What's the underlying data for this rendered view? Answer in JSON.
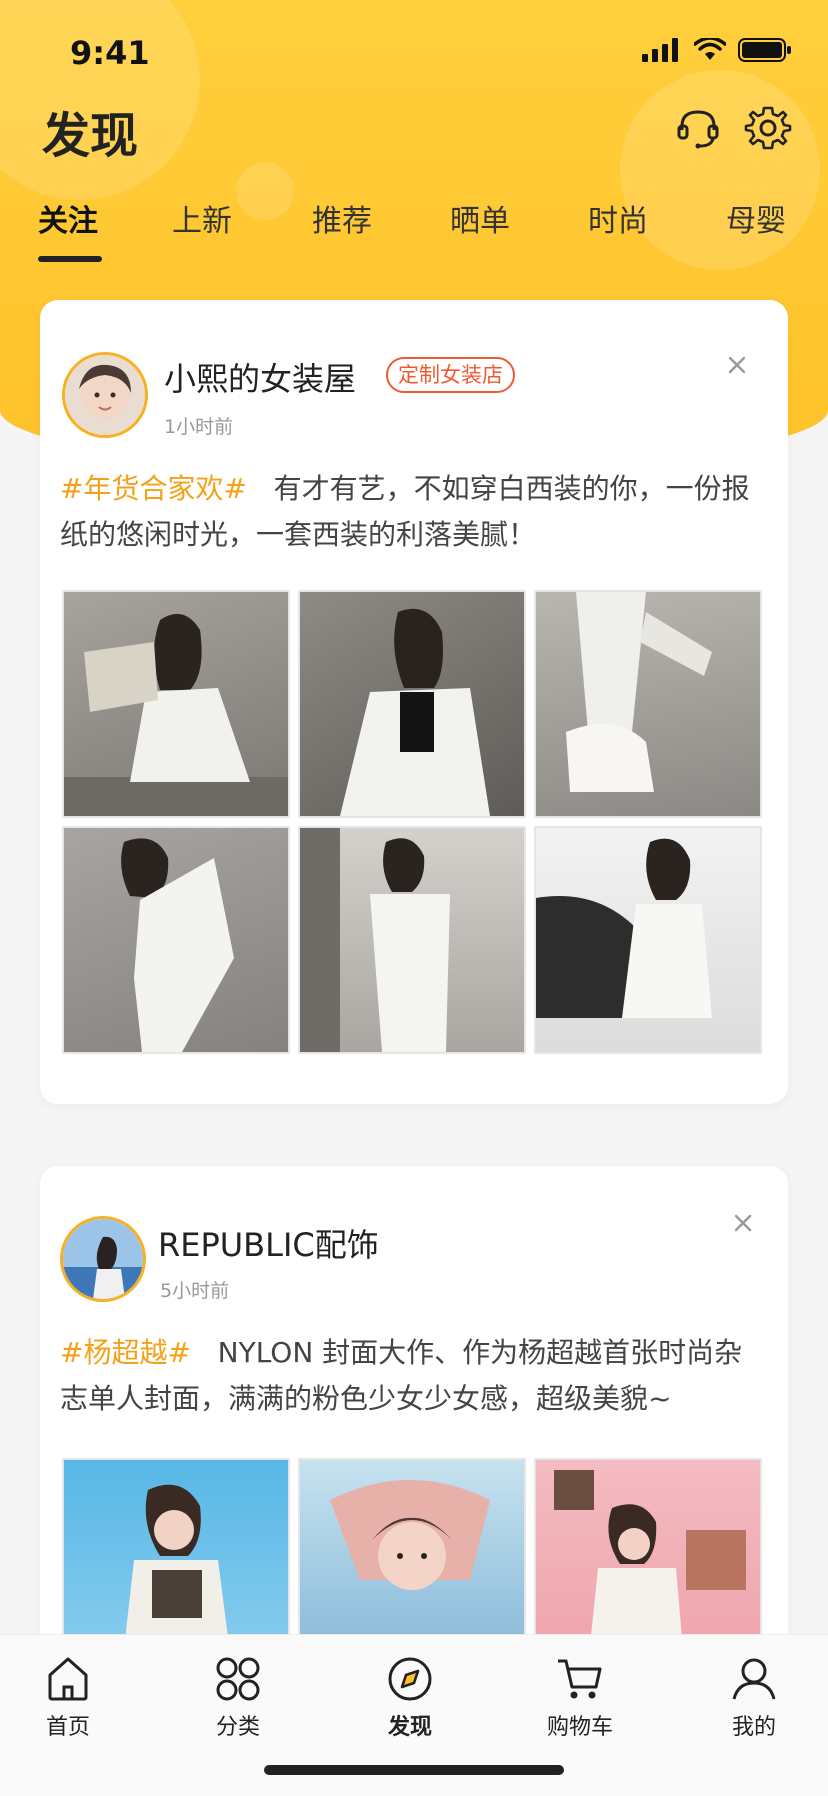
{
  "status_bar": {
    "time": "9:41"
  },
  "header": {
    "title": "发现",
    "service_icon": "headset-icon",
    "settings_icon": "gear-icon",
    "bg_color": "#ffc22a"
  },
  "tabs": [
    {
      "label": "关注",
      "active": true
    },
    {
      "label": "上新",
      "active": false
    },
    {
      "label": "推荐",
      "active": false
    },
    {
      "label": "晒单",
      "active": false
    },
    {
      "label": "时尚",
      "active": false
    },
    {
      "label": "母婴",
      "active": false
    }
  ],
  "posts": [
    {
      "author": "小熙的女装屋",
      "badge": "定制女装店",
      "time": "1小时前",
      "tag": "#年货合家欢#",
      "text": "有才有艺，不如穿白西装的你，一份报纸的悠闲时光，一套西装的利落美腻！",
      "images": [
        "photo-1",
        "photo-2",
        "photo-3",
        "photo-4",
        "photo-5",
        "photo-6"
      ]
    },
    {
      "author": "REPUBLIC配饰",
      "time": "5小时前",
      "tag": "#杨超越#",
      "text": "NYLON 封面大作、作为杨超越首张时尚杂志单人封面，满满的粉色少女少女感，超级美貌~",
      "images": [
        "photo-1",
        "photo-2",
        "photo-3"
      ]
    }
  ],
  "tabbar": [
    {
      "label": "首页",
      "icon": "home-icon",
      "active": false
    },
    {
      "label": "分类",
      "icon": "category-icon",
      "active": false
    },
    {
      "label": "发现",
      "icon": "discover-icon",
      "active": true
    },
    {
      "label": "购物车",
      "icon": "cart-icon",
      "active": false
    },
    {
      "label": "我的",
      "icon": "profile-icon",
      "active": false
    }
  ],
  "colors": {
    "accent": "#f3a218",
    "badge": "#f05a32",
    "header": "#ffc22a"
  }
}
